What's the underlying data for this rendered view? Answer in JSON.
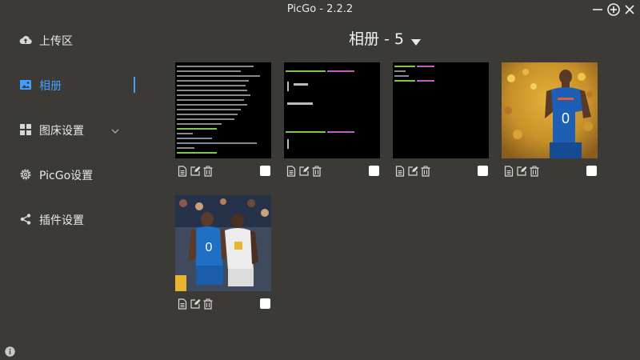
{
  "window": {
    "title": "PicGo - 2.2.2"
  },
  "sidebar": {
    "items": [
      {
        "label": "上传区",
        "icon": "cloud-upload-icon"
      },
      {
        "label": "相册",
        "icon": "image-icon",
        "active": true
      },
      {
        "label": "图床设置",
        "icon": "grid-icon"
      },
      {
        "label": "PicGo设置",
        "icon": "gear-icon"
      },
      {
        "label": "插件设置",
        "icon": "share-icon"
      }
    ]
  },
  "gallery": {
    "title": "相册 - 5",
    "images": [
      {
        "kind": "terminal-log"
      },
      {
        "kind": "terminal-node-version"
      },
      {
        "kind": "terminal-short"
      },
      {
        "kind": "basketball-player-back"
      },
      {
        "kind": "basketball-two-players"
      }
    ]
  },
  "colors": {
    "background": "#3c3a37",
    "accent": "#409eff"
  }
}
